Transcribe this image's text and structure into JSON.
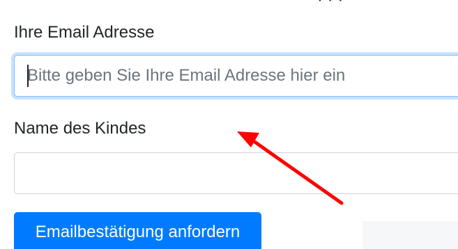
{
  "top_cut_text": "· ·  ·",
  "email": {
    "label": "Ihre Email Adresse",
    "placeholder": "Bitte geben Sie Ihre Email Adresse hier ein",
    "value": ""
  },
  "child_name": {
    "label": "Name des Kindes",
    "value": ""
  },
  "submit_label": "Emailbestätigung anfordern",
  "colors": {
    "primary": "#007bff",
    "focus_border": "#80bdff",
    "annotation_arrow": "#ff0000"
  }
}
